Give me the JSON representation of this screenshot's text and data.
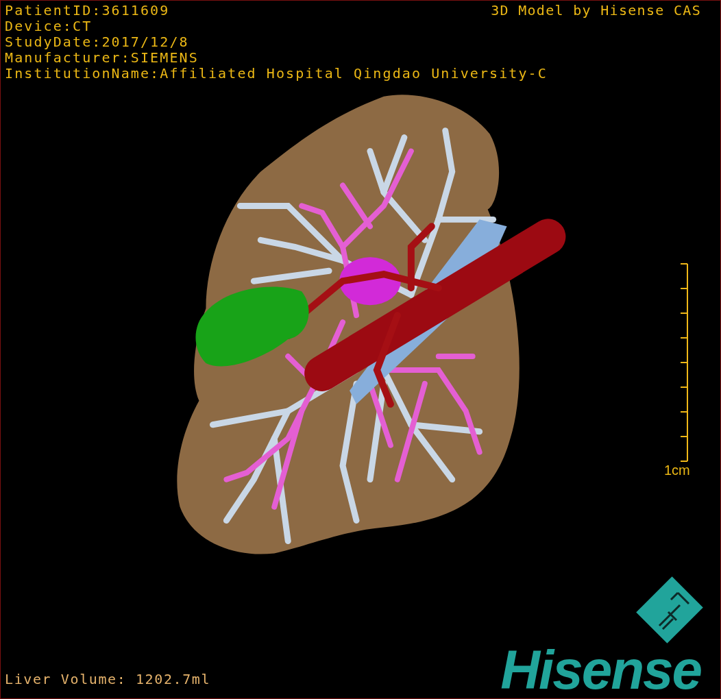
{
  "overlay": {
    "patient_info": [
      "PatientID:3611609",
      "Device:CT",
      "StudyDate:2017/12/8",
      "Manufacturer:SIEMENS",
      "InstitutionName:Affiliated Hospital Qingdao University-C"
    ],
    "title": "3D Model by Hisense CAS",
    "scale_bar": {
      "label": "1cm"
    },
    "liver_volume": "Liver Volume: 1202.7ml"
  },
  "logo": {
    "wordmark": "Hisense"
  }
}
